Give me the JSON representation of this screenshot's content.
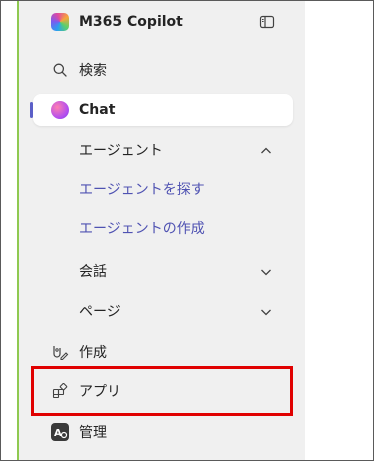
{
  "app": {
    "title": "M365 Copilot",
    "brand_icon": "copilot-logo",
    "panel_toggle_icon": "sidebar-toggle-icon"
  },
  "nav": {
    "search": {
      "label": "検索",
      "icon": "search-icon"
    },
    "chat": {
      "label": "Chat",
      "icon": "chat-icon",
      "active": true
    },
    "agents": {
      "label": "エージェント",
      "expanded": true
    },
    "agents_find": {
      "label": "エージェントを探す"
    },
    "agents_create": {
      "label": "エージェントの作成"
    },
    "conversations": {
      "label": "会話",
      "expanded": false
    },
    "pages": {
      "label": "ページ",
      "expanded": false
    },
    "create": {
      "label": "作成",
      "icon": "create-icon"
    },
    "apps": {
      "label": "アプリ",
      "icon": "apps-icon",
      "highlighted": true
    },
    "admin": {
      "label": "管理",
      "icon": "admin-icon"
    }
  },
  "colors": {
    "accent": "#5b5fc7",
    "link": "#4f52b2",
    "highlight_border": "#e00000",
    "sidebar_bg": "#f0f0f0",
    "left_stripe": "#8fc951"
  }
}
